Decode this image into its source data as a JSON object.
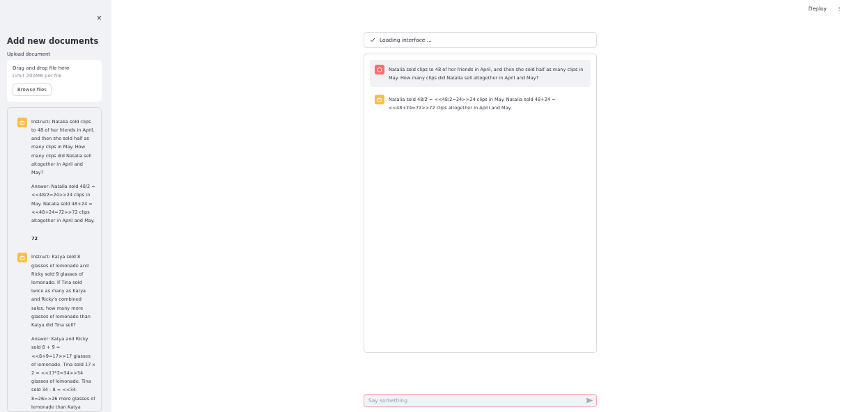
{
  "sidebar": {
    "close": "×",
    "title": "Add new documents",
    "upload": {
      "label": "Upload document",
      "hint": "Drag and drop file here",
      "limit": "Limit 200MB per file",
      "button": "Browse files"
    },
    "history": [
      {
        "kind": "assistant",
        "paragraphs": [
          {
            "kind": "text",
            "text": "Instruct: Natalia sold clips to 48 of her friends in April, and then she sold half as many clips in May. How many clips did Natalia sell altogether in April and May?"
          },
          {
            "kind": "text",
            "text": "Answer: Natalia sold 48/2 = <<48/2=24>>24 clips in May. Natalia sold 48+24 = <<48+24=72>>72 clips altogether in April and May."
          },
          {
            "kind": "result",
            "text": "72"
          }
        ]
      },
      {
        "kind": "assistant",
        "paragraphs": [
          {
            "kind": "text",
            "text": "Instruct: Katya sold 8 glasses of lemonade and Ricky sold 9 glasses of lemonade. If Tina sold twice as many as Katya and Ricky's combined sales, how many more glasses of lemonade than Katya did Tina sell?"
          },
          {
            "kind": "text",
            "text": "Answer: Katya and Ricky sold 8 + 9 = <<8+9=17>>17 glasses of lemonade. Tina sold 17 x 2 = <<17*2=34>>34 glasses of lemonade. Tina sold 34 - 8 = <<34-8=26>>26 more glasses of lemonade than Katya"
          }
        ]
      }
    ]
  },
  "header": {
    "deploy": "Deploy",
    "menu": "⋮"
  },
  "status": {
    "text": "Loading interface ..."
  },
  "chat": [
    {
      "kind": "user",
      "text": "Natalia sold clips to 48 of her friends in April, and then she sold half as many clips in May. How many clips did Natalia sell altogether in April and May?"
    },
    {
      "kind": "assistant",
      "text": "Natalia sold 48/2 = <<48/2=24>>24 clips in May. Natalia sold 48+24 = <<48+24=72>>72 clips altogether in April and May."
    }
  ],
  "input": {
    "placeholder": "Say something"
  }
}
